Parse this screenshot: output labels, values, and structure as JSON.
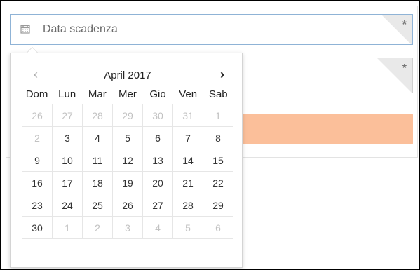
{
  "form": {
    "date_field": {
      "placeholder": "Data scadenza",
      "required_mark": "*"
    },
    "second_field": {
      "required_mark": "*"
    },
    "button_color": "#fbbf9a"
  },
  "calendar": {
    "title": "April 2017",
    "prev_glyph": "‹",
    "next_glyph": "›",
    "weekdays": [
      "Dom",
      "Lun",
      "Mar",
      "Mer",
      "Gio",
      "Ven",
      "Sab"
    ],
    "weeks": [
      [
        {
          "d": "26",
          "m": true
        },
        {
          "d": "27",
          "m": true
        },
        {
          "d": "28",
          "m": true
        },
        {
          "d": "29",
          "m": true
        },
        {
          "d": "30",
          "m": true
        },
        {
          "d": "31",
          "m": true
        },
        {
          "d": "1",
          "m": true
        }
      ],
      [
        {
          "d": "2",
          "m": true
        },
        {
          "d": "3",
          "m": false
        },
        {
          "d": "4",
          "m": false
        },
        {
          "d": "5",
          "m": false
        },
        {
          "d": "6",
          "m": false
        },
        {
          "d": "7",
          "m": false
        },
        {
          "d": "8",
          "m": false
        }
      ],
      [
        {
          "d": "9",
          "m": false
        },
        {
          "d": "10",
          "m": false
        },
        {
          "d": "11",
          "m": false
        },
        {
          "d": "12",
          "m": false
        },
        {
          "d": "13",
          "m": false
        },
        {
          "d": "14",
          "m": false
        },
        {
          "d": "15",
          "m": false
        }
      ],
      [
        {
          "d": "16",
          "m": false
        },
        {
          "d": "17",
          "m": false
        },
        {
          "d": "18",
          "m": false
        },
        {
          "d": "19",
          "m": false
        },
        {
          "d": "20",
          "m": false
        },
        {
          "d": "21",
          "m": false
        },
        {
          "d": "22",
          "m": false
        }
      ],
      [
        {
          "d": "23",
          "m": false
        },
        {
          "d": "24",
          "m": false
        },
        {
          "d": "25",
          "m": false
        },
        {
          "d": "26",
          "m": false
        },
        {
          "d": "27",
          "m": false
        },
        {
          "d": "28",
          "m": false
        },
        {
          "d": "29",
          "m": false
        }
      ],
      [
        {
          "d": "30",
          "m": false
        },
        {
          "d": "1",
          "m": true
        },
        {
          "d": "2",
          "m": true
        },
        {
          "d": "3",
          "m": true
        },
        {
          "d": "4",
          "m": true
        },
        {
          "d": "5",
          "m": true
        },
        {
          "d": "6",
          "m": true
        }
      ]
    ]
  }
}
